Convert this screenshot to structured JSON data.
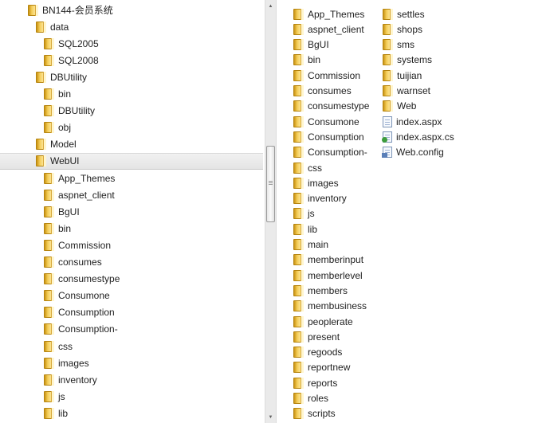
{
  "tree": {
    "items": [
      {
        "label": "BN144-会员系统",
        "indent": 0,
        "selected": false
      },
      {
        "label": "data",
        "indent": 1,
        "selected": false
      },
      {
        "label": "SQL2005",
        "indent": 2,
        "selected": false
      },
      {
        "label": "SQL2008",
        "indent": 2,
        "selected": false
      },
      {
        "label": "DBUtility",
        "indent": 1,
        "selected": false
      },
      {
        "label": "bin",
        "indent": 2,
        "selected": false
      },
      {
        "label": "DBUtility",
        "indent": 2,
        "selected": false
      },
      {
        "label": "obj",
        "indent": 2,
        "selected": false
      },
      {
        "label": "Model",
        "indent": 1,
        "selected": false
      },
      {
        "label": "WebUI",
        "indent": 1,
        "selected": true
      },
      {
        "label": "App_Themes",
        "indent": 2,
        "selected": false
      },
      {
        "label": "aspnet_client",
        "indent": 2,
        "selected": false
      },
      {
        "label": "BgUI",
        "indent": 2,
        "selected": false
      },
      {
        "label": "bin",
        "indent": 2,
        "selected": false
      },
      {
        "label": "Commission",
        "indent": 2,
        "selected": false
      },
      {
        "label": "consumes",
        "indent": 2,
        "selected": false
      },
      {
        "label": "consumestype",
        "indent": 2,
        "selected": false
      },
      {
        "label": "Consumone",
        "indent": 2,
        "selected": false
      },
      {
        "label": "Consumption",
        "indent": 2,
        "selected": false
      },
      {
        "label": "Consumption-",
        "indent": 2,
        "selected": false
      },
      {
        "label": "css",
        "indent": 2,
        "selected": false
      },
      {
        "label": "images",
        "indent": 2,
        "selected": false
      },
      {
        "label": "inventory",
        "indent": 2,
        "selected": false
      },
      {
        "label": "js",
        "indent": 2,
        "selected": false
      },
      {
        "label": "lib",
        "indent": 2,
        "selected": false
      }
    ]
  },
  "scrollbar": {
    "up_arrow": "▲",
    "down_arrow": "▼"
  },
  "files": {
    "columns": [
      [
        {
          "name": "App_Themes",
          "type": "folder"
        },
        {
          "name": "aspnet_client",
          "type": "folder"
        },
        {
          "name": "BgUI",
          "type": "folder"
        },
        {
          "name": "bin",
          "type": "folder"
        },
        {
          "name": "Commission",
          "type": "folder"
        },
        {
          "name": "consumes",
          "type": "folder"
        },
        {
          "name": "consumestype",
          "type": "folder"
        },
        {
          "name": "Consumone",
          "type": "folder"
        },
        {
          "name": "Consumption",
          "type": "folder"
        },
        {
          "name": "Consumption-",
          "type": "folder"
        },
        {
          "name": "css",
          "type": "folder"
        },
        {
          "name": "images",
          "type": "folder"
        },
        {
          "name": "inventory",
          "type": "folder"
        },
        {
          "name": "js",
          "type": "folder"
        },
        {
          "name": "lib",
          "type": "folder"
        },
        {
          "name": "main",
          "type": "folder"
        },
        {
          "name": "memberinput",
          "type": "folder"
        },
        {
          "name": "memberlevel",
          "type": "folder"
        },
        {
          "name": "members",
          "type": "folder"
        },
        {
          "name": "membusiness",
          "type": "folder"
        },
        {
          "name": "peoplerate",
          "type": "folder"
        },
        {
          "name": "present",
          "type": "folder"
        },
        {
          "name": "regoods",
          "type": "folder"
        },
        {
          "name": "reportnew",
          "type": "folder"
        },
        {
          "name": "reports",
          "type": "folder"
        },
        {
          "name": "roles",
          "type": "folder"
        },
        {
          "name": "scripts",
          "type": "folder"
        }
      ],
      [
        {
          "name": "settles",
          "type": "folder"
        },
        {
          "name": "shops",
          "type": "folder"
        },
        {
          "name": "sms",
          "type": "folder"
        },
        {
          "name": "systems",
          "type": "folder"
        },
        {
          "name": "tuijian",
          "type": "folder"
        },
        {
          "name": "warnset",
          "type": "folder"
        },
        {
          "name": "Web",
          "type": "folder"
        },
        {
          "name": "index.aspx",
          "type": "aspx"
        },
        {
          "name": "index.aspx.cs",
          "type": "cs"
        },
        {
          "name": "Web.config",
          "type": "config"
        }
      ]
    ]
  },
  "icons": {
    "folder": "folder-icon",
    "aspx": "aspx-file-icon",
    "cs": "cs-file-icon",
    "config": "config-file-icon"
  }
}
